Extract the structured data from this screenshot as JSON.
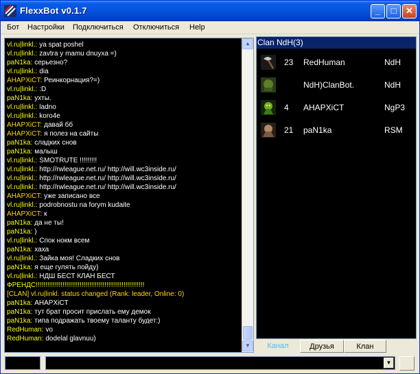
{
  "window": {
    "title": "FlexxBot v0.1.7"
  },
  "menu": [
    "Бот",
    "Настройки",
    "Подключиться",
    "Отключиться",
    "Help"
  ],
  "chat": [
    {
      "who": "vl.ru|linkl.:",
      "text": "ya spat poshel",
      "color": "yellow"
    },
    {
      "who": "vl.ru|linkl.:",
      "text": "zavtra y mamu dnuyxa =)",
      "color": "yellow"
    },
    {
      "who": "paN1ka:",
      "text": "серьезно?",
      "color": "yellow"
    },
    {
      "who": "vl.ru|linkl.:",
      "text": "dia",
      "color": "yellow"
    },
    {
      "who": "AHAPXiCT:",
      "text": "Реинкорнация?=)",
      "color": "orange"
    },
    {
      "who": "vl.ru|linkl.:",
      "text": ":D",
      "color": "yellow"
    },
    {
      "who": "paN1ka:",
      "text": "ухты.",
      "color": "yellow"
    },
    {
      "who": "vl.ru|linkl.:",
      "text": "ladno",
      "color": "yellow"
    },
    {
      "who": "vl.ru|linkl.:",
      "text": "koro4e",
      "color": "yellow"
    },
    {
      "who": "AHAPXiCT:",
      "text": "давай бб",
      "color": "orange"
    },
    {
      "who": "AHAPXiCT:",
      "text": "я полез на сайты",
      "color": "orange"
    },
    {
      "who": "paN1ka:",
      "text": "сладких снов",
      "color": "yellow"
    },
    {
      "who": "paN1ka:",
      "text": "малыш",
      "color": "yellow"
    },
    {
      "who": "vl.ru|linkl.:",
      "text": "SMOTRUTE !!!!!!!!!",
      "color": "yellow"
    },
    {
      "who": "vl.ru|linkl.:",
      "text": "http://rwleague.net.ru/  http://will.wc3inside.ru/",
      "color": "yellow"
    },
    {
      "who": "vl.ru|linkl.:",
      "text": "http://rwleague.net.ru/  http://will.wc3inside.ru/",
      "color": "yellow"
    },
    {
      "who": "vl.ru|linkl.:",
      "text": "http://rwleague.net.ru/  http://will.wc3inside.ru/",
      "color": "yellow"
    },
    {
      "who": "AHAPXiCT:",
      "text": "уже записано все",
      "color": "orange"
    },
    {
      "who": "vl.ru|linkl.:",
      "text": "podrobnostu na forym kudaite",
      "color": "yellow"
    },
    {
      "who": "AHAPXiCT:",
      "text": "к",
      "color": "orange"
    },
    {
      "who": "paN1ka:",
      "text": "да не ты!",
      "color": "yellow"
    },
    {
      "who": "paN1ka:",
      "text": ")",
      "color": "yellow"
    },
    {
      "who": "vl.ru|linkl.:",
      "text": "Спок нокм всем",
      "color": "yellow"
    },
    {
      "who": "paN1ka:",
      "text": "хаха",
      "color": "yellow"
    },
    {
      "who": "vl.ru|linkl.:",
      "text": "Зайка моя! Сладких снов",
      "color": "yellow"
    },
    {
      "who": "paN1ka:",
      "text": "я еще гулять пойду)",
      "color": "yellow"
    },
    {
      "who": "vl.ru|linkl.:",
      "text": "НДШ БЕСТ КЛАН БЕСТ",
      "color": "yellow"
    },
    {
      "who": "",
      "text": "ФРЕНДС!!!!!!!!!!!!!!!!!!!!!!!!!!!!!!!!!!!!!!!!!!!!!!!!!!!!!!!!!",
      "color": "yellow"
    },
    {
      "who": "",
      "text": "[CLAN] vl.ru|linkl. status changed (Rank: leader, Online: 0)",
      "color": "orange"
    },
    {
      "who": "paN1ka:",
      "text": "AHAPXiCT",
      "color": "yellow"
    },
    {
      "who": "paN1ka:",
      "text": "тут брат просит прислать ему демок",
      "color": "yellow"
    },
    {
      "who": "paN1ka:",
      "text": "типа подражать твоему таланту будет:)",
      "color": "yellow"
    },
    {
      "who": "RedHuman:",
      "text": "vo",
      "color": "yellow"
    },
    {
      "who": "RedHuman:",
      "text": "dodelal glavnuu)",
      "color": "yellow"
    }
  ],
  "clan": {
    "header": "Clan NdH(3)",
    "members": [
      {
        "level": "23",
        "name": "RedHuman",
        "tag": "NdH",
        "avatar": "axe-icon"
      },
      {
        "level": "",
        "name": "NdH)ClanBot.",
        "tag": "NdH",
        "avatar": "bot-icon"
      },
      {
        "level": "4",
        "name": "AHAPXiCT",
        "tag": "NgP3",
        "avatar": "hero-icon"
      },
      {
        "level": "21",
        "name": "paN1ka",
        "tag": "RSM",
        "avatar": "unit-icon"
      }
    ]
  },
  "tabs": [
    "Канал",
    "Друзья",
    "Клан"
  ],
  "colors": {
    "chat_name": "#ffff00",
    "clan_header": "#0a246a",
    "active_tab": "#4fb7ff"
  }
}
